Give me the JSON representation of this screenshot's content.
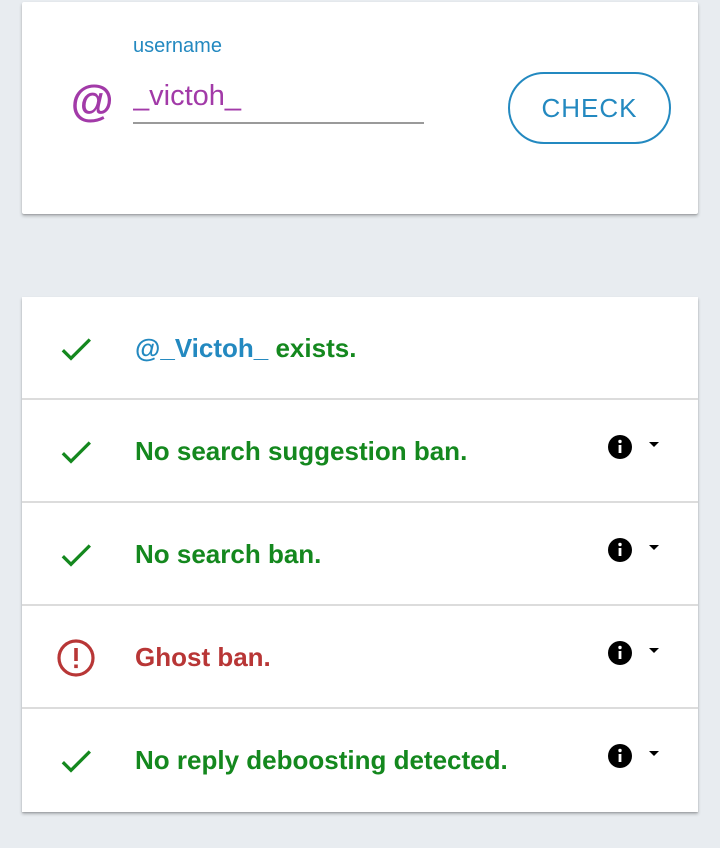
{
  "search": {
    "label": "username",
    "value": "_victoh_",
    "at_symbol": "@",
    "button_label": "CHECK"
  },
  "results": [
    {
      "status": "ok",
      "handle": "@_Victoh_",
      "text": " exists.",
      "has_info": false
    },
    {
      "status": "ok",
      "text": "No search suggestion ban.",
      "has_info": true
    },
    {
      "status": "ok",
      "text": "No search ban.",
      "has_info": true
    },
    {
      "status": "bad",
      "text": "Ghost ban.",
      "has_info": true
    },
    {
      "status": "ok",
      "text": "No reply deboosting detected.",
      "has_info": true
    }
  ],
  "colors": {
    "accent_blue": "#2389c0",
    "handle_purple": "#a23aa8",
    "ok_green": "#14881e",
    "bad_red": "#b83636"
  },
  "icons": {
    "ok": "check-icon",
    "bad": "alert-circle-icon",
    "info": "info-icon",
    "expand": "dropdown-arrow-icon"
  }
}
